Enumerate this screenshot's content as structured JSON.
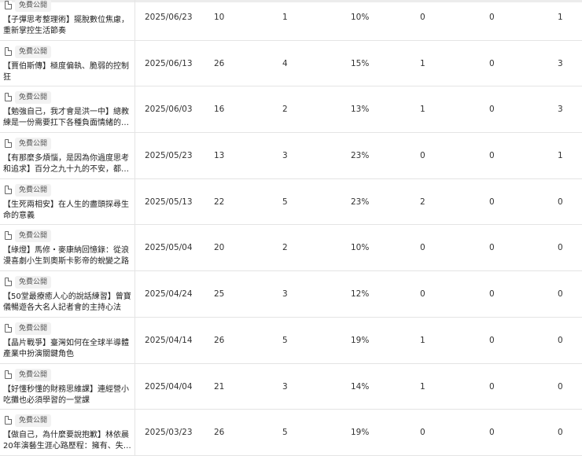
{
  "badge_label": "免費公開",
  "rows": [
    {
      "title": "【子彈思考整理術】擺脫數位焦慮，重新掌控生活節奏",
      "date": "2025/06/23",
      "v1": "10",
      "v2": "1",
      "pct": "10%",
      "v3": "0",
      "v4": "0",
      "v5": "1"
    },
    {
      "title": "【賈伯斯傳】極度偏執、脆弱的控制狂",
      "date": "2025/06/13",
      "v1": "26",
      "v2": "4",
      "pct": "15%",
      "v3": "1",
      "v4": "0",
      "v5": "3"
    },
    {
      "title": "【勉強自己，我才會是洪一中】總教練是一份需要扛下各種負面情緒的…",
      "date": "2025/06/03",
      "v1": "16",
      "v2": "2",
      "pct": "13%",
      "v3": "1",
      "v4": "0",
      "v5": "3"
    },
    {
      "title": "【有那麼多煩惱，是因為你過度思考和追求】百分之九十九的不安，都…",
      "date": "2025/05/23",
      "v1": "13",
      "v2": "3",
      "pct": "23%",
      "v3": "0",
      "v4": "0",
      "v5": "1"
    },
    {
      "title": "【生死兩相安】在人生的盡頭探尋生命的意義",
      "date": "2025/05/13",
      "v1": "22",
      "v2": "5",
      "pct": "23%",
      "v3": "2",
      "v4": "0",
      "v5": "0"
    },
    {
      "title": "【綠燈】馬修・麥康納回憶錄：從浪漫喜劇小生到奧斯卡影帝的蛻變之路",
      "date": "2025/05/04",
      "v1": "20",
      "v2": "2",
      "pct": "10%",
      "v3": "0",
      "v4": "0",
      "v5": "0"
    },
    {
      "title": "【50堂最療癒人心的說話練習】曾寶儀暢遊各大名人記者會的主持心法",
      "date": "2025/04/24",
      "v1": "25",
      "v2": "3",
      "pct": "12%",
      "v3": "0",
      "v4": "0",
      "v5": "0"
    },
    {
      "title": "【晶片戰爭】臺灣如何在全球半導體產業中扮演關鍵角色",
      "date": "2025/04/14",
      "v1": "26",
      "v2": "5",
      "pct": "19%",
      "v3": "1",
      "v4": "0",
      "v5": "0"
    },
    {
      "title": "【好懂秒懂的財務思維課】連經營小吃攤也必須學習的一堂課",
      "date": "2025/04/04",
      "v1": "21",
      "v2": "3",
      "pct": "14%",
      "v3": "1",
      "v4": "0",
      "v5": "0"
    },
    {
      "title": "【做自己，為什麼要說抱歉】林依晨20年演藝生涯心路歷程：擁有、失去…",
      "date": "2025/03/23",
      "v1": "26",
      "v2": "5",
      "pct": "19%",
      "v3": "0",
      "v4": "0",
      "v5": "0"
    }
  ]
}
